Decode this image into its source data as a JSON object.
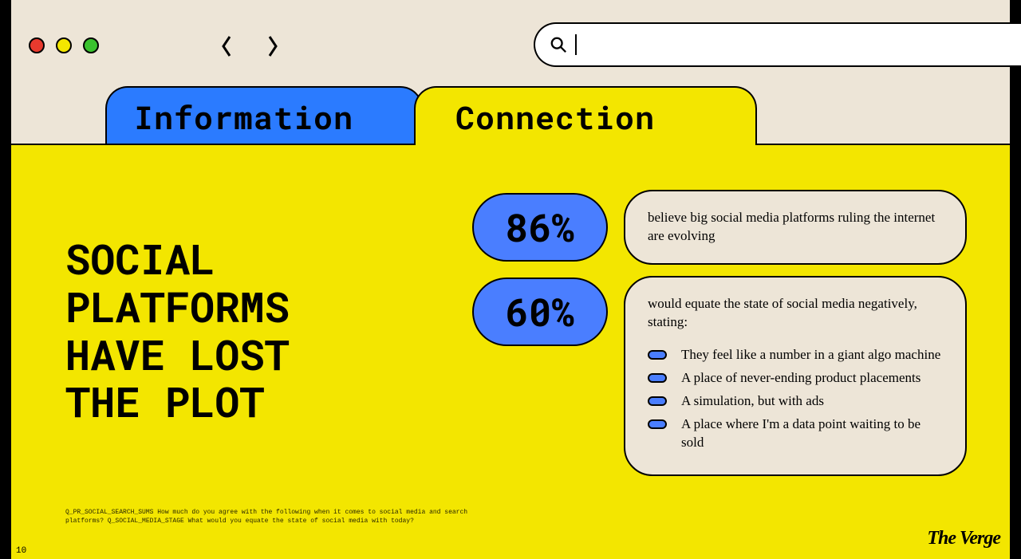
{
  "tabs": {
    "left": "Information",
    "right": "Connection"
  },
  "headline": "SOCIAL\nPLATFORMS\nHAVE LOST\nTHE PLOT",
  "stats": [
    {
      "value": "86%",
      "text": "believe big social media platforms ruling the internet are evolving"
    },
    {
      "value": "60%",
      "text": "would equate the state of social media negatively, stating:",
      "bullets": [
        "They feel like a number in a giant algo machine",
        "A place of never-ending product placements",
        "A simulation, but with ads",
        "A place where I'm a data point waiting to be sold"
      ]
    }
  ],
  "footnote": "Q_PR_SOCIAL_SEARCH_SUMS How much do you agree with the following when it comes to social media and search platforms?\nQ_SOCIAL_MEDIA_STAGE What would you equate the state of social media with today?",
  "page_number": "10",
  "logo": "The Verge"
}
